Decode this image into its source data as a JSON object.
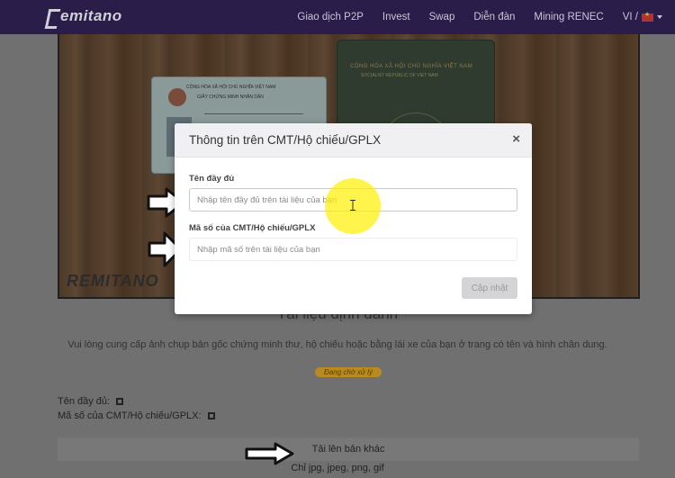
{
  "header": {
    "logo_text": "emitano",
    "nav": [
      "Giao dịch P2P",
      "Invest",
      "Swap",
      "Diễn đàn",
      "Mining RENEC"
    ],
    "language": "VI /"
  },
  "background": {
    "watermark": "REMITANO",
    "card_header_1": "CỘNG HÒA XÃ HỘI CHỦ NGHĨA VIỆT NAM",
    "card_header_2": "GIẤY CHỨNG MINH NHÂN DÂN",
    "passport_line_1": "CỘNG HÒA XÃ HỘI CHỦ NGHĨA VIỆT NAM",
    "passport_line_2": "SOCIALIST REPUBLIC OF VIET NAM",
    "section_title": "Tài liệu định danh",
    "section_description": "Vui lòng cung cấp ảnh chụp bản gốc chứng minh thư, hộ chiếu hoặc bằng lái xe của bạn ở trang có tên và hình chân dung.",
    "status_badge": "Đang chờ xử lý",
    "full_name_label": "Tên đầy đủ:",
    "id_number_label": "Mã số của CMT/Hộ chiếu/GPLX:",
    "upload_label": "Tải lên bản khác",
    "formats": "Chỉ jpg, jpeg, png, gif"
  },
  "modal": {
    "title": "Thông tin trên CMT/Hộ chiếu/GPLX",
    "close_symbol": "×",
    "full_name": {
      "label": "Tên đầy đủ",
      "value": "",
      "placeholder": "Nhập tên đầy đủ trên tài liệu của bạn"
    },
    "id_number": {
      "label": "Mã số của CMT/Hộ chiếu/GPLX",
      "value": "",
      "placeholder": "Nhập mã số trên tài liệu của bạn"
    },
    "submit_label": "Cập nhật"
  },
  "colors": {
    "header_bg": "#2a1d4a",
    "highlight": "#fff000",
    "badge": "#b98a1f"
  }
}
